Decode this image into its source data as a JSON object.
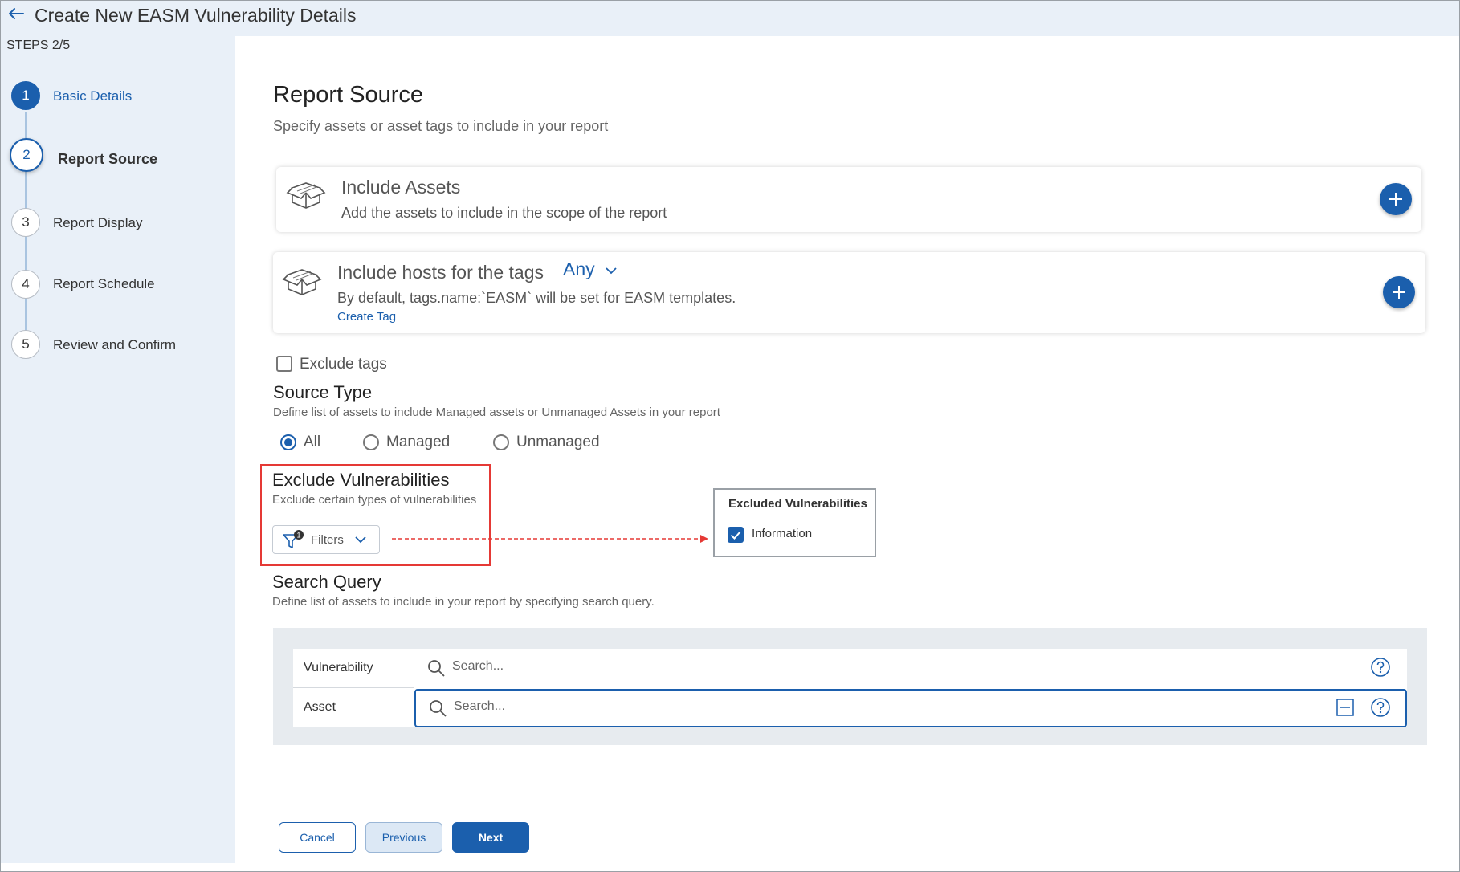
{
  "header": {
    "title": "Create New EASM Vulnerability Details"
  },
  "sidebar": {
    "steps_count": "STEPS 2/5",
    "steps": [
      {
        "number": "1",
        "label": "Basic Details"
      },
      {
        "number": "2",
        "label": "Report Source"
      },
      {
        "number": "3",
        "label": "Report Display"
      },
      {
        "number": "4",
        "label": "Report Schedule"
      },
      {
        "number": "5",
        "label": "Review and Confirm"
      }
    ]
  },
  "section": {
    "title": "Report Source",
    "subtitle": "Specify assets or asset tags to include in your report"
  },
  "include_assets": {
    "title": "Include Assets",
    "subtitle": "Add the assets to include in the scope of the report"
  },
  "include_tags": {
    "title": "Include hosts for the tags",
    "match_value": "Any",
    "subtitle": "By default, tags.name:`EASM` will be set for EASM templates.",
    "create_tag": "Create Tag"
  },
  "exclude_tags": {
    "label": "Exclude tags",
    "checked": false
  },
  "source_type": {
    "title": "Source Type",
    "description": "Define list of assets to include Managed assets or Unmanaged Assets in your report",
    "options": [
      "All",
      "Managed",
      "Unmanaged"
    ],
    "selected": "All"
  },
  "exclude_vulns": {
    "title": "Exclude Vulnerabilities",
    "description": "Exclude certain types of vulnerabilities",
    "filters_label": "Filters",
    "filters_count": "1",
    "popup_title": "Excluded Vulnerabilities",
    "popup_item": "Information"
  },
  "search_query": {
    "title": "Search Query",
    "description": "Define list of assets to include in your report by specifying search query.",
    "rows": [
      {
        "label": "Vulnerability",
        "placeholder": "Search..."
      },
      {
        "label": "Asset",
        "placeholder": "Search..."
      }
    ]
  },
  "footer": {
    "cancel": "Cancel",
    "previous": "Previous",
    "next": "Next"
  },
  "colors": {
    "accent": "#1b5fad",
    "sidebar_bg": "#e9f0f8",
    "highlight_red": "#e53935"
  }
}
